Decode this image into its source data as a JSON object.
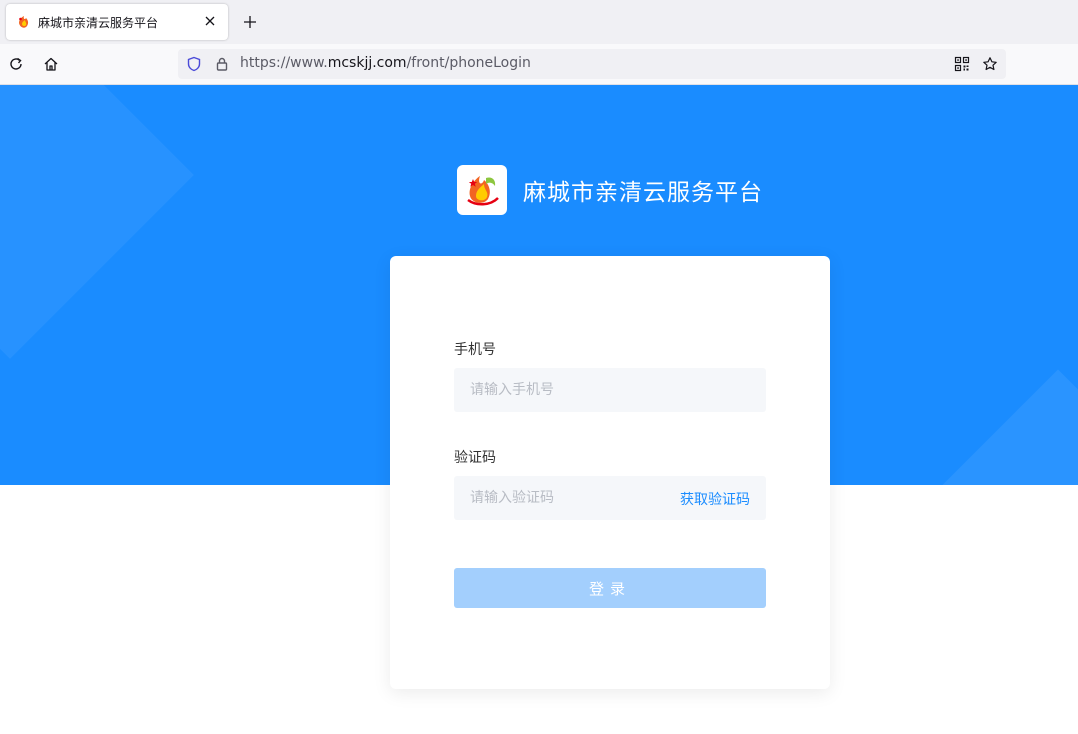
{
  "browser": {
    "tab": {
      "title": "麻城市亲清云服务平台",
      "favicon": "flame-logo-icon"
    },
    "url": {
      "scheme": "https://www.",
      "host": "mcskjj.com",
      "path": "/front/phoneLogin"
    },
    "icons": {
      "reload": "reload-icon",
      "home": "home-icon",
      "shield": "shield-icon",
      "lock": "lock-icon",
      "qr": "qr-code-icon",
      "bookmark": "star-icon",
      "close_tab": "close-icon",
      "new_tab": "plus-icon"
    }
  },
  "page": {
    "brand": {
      "name": "麻城市亲清云服务平台",
      "logo": "flame-logo-icon"
    },
    "form": {
      "phone_label": "手机号",
      "phone_placeholder": "请输入手机号",
      "code_label": "验证码",
      "code_placeholder": "请输入验证码",
      "get_code": "获取验证码",
      "login": "登录"
    },
    "colors": {
      "primary": "#1a8cff",
      "button_disabled": "#a3cffd",
      "field_bg": "#f5f7fa"
    }
  }
}
